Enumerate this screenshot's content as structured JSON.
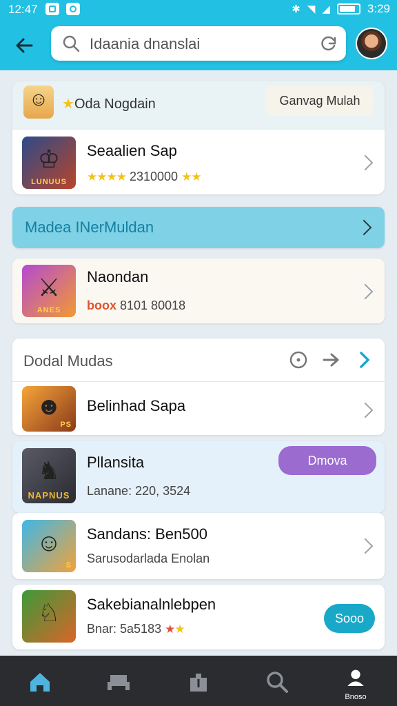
{
  "status_bar": {
    "time_left": "12:47",
    "time_right": "3:29"
  },
  "header": {
    "search_text": "Idaania dnanslai",
    "avatar_icon": "avatar-portrait"
  },
  "featured": {
    "label": "Oda Nogdain",
    "button": "Ganvag Mulah"
  },
  "items": [
    {
      "title": "Seaalien Sap",
      "meta": "2310000",
      "rating": 4,
      "thumb_tag": "LUNUUS"
    },
    {
      "title": "Naondan",
      "badge": "boox",
      "meta": "8101 80018",
      "thumb_tag": "ANES"
    },
    {
      "title": "Belinhad Sapa",
      "thumb_tag": "PS"
    },
    {
      "title": "Pllansita",
      "meta": "Lanane: 220, 3524",
      "action": "Dmova",
      "thumb_tag": "NAPNUS"
    },
    {
      "title": "Sandans: Ben500",
      "meta": "Sarusodarlada Enolan",
      "thumb_tag": "S"
    },
    {
      "title": "Sakebianalnlebpen",
      "meta": "Bnar: 5a5183",
      "action": "Sooo",
      "thumb_tag": ""
    }
  ],
  "banner": {
    "label": "Madea INerMuldan"
  },
  "section": {
    "title": "Dodal Mudas"
  },
  "nav": {
    "profile_label": "Bnoso"
  },
  "colors": {
    "accent": "#22c0e2",
    "purple": "#9b6bd0",
    "teal_button": "#1aa8c9"
  }
}
